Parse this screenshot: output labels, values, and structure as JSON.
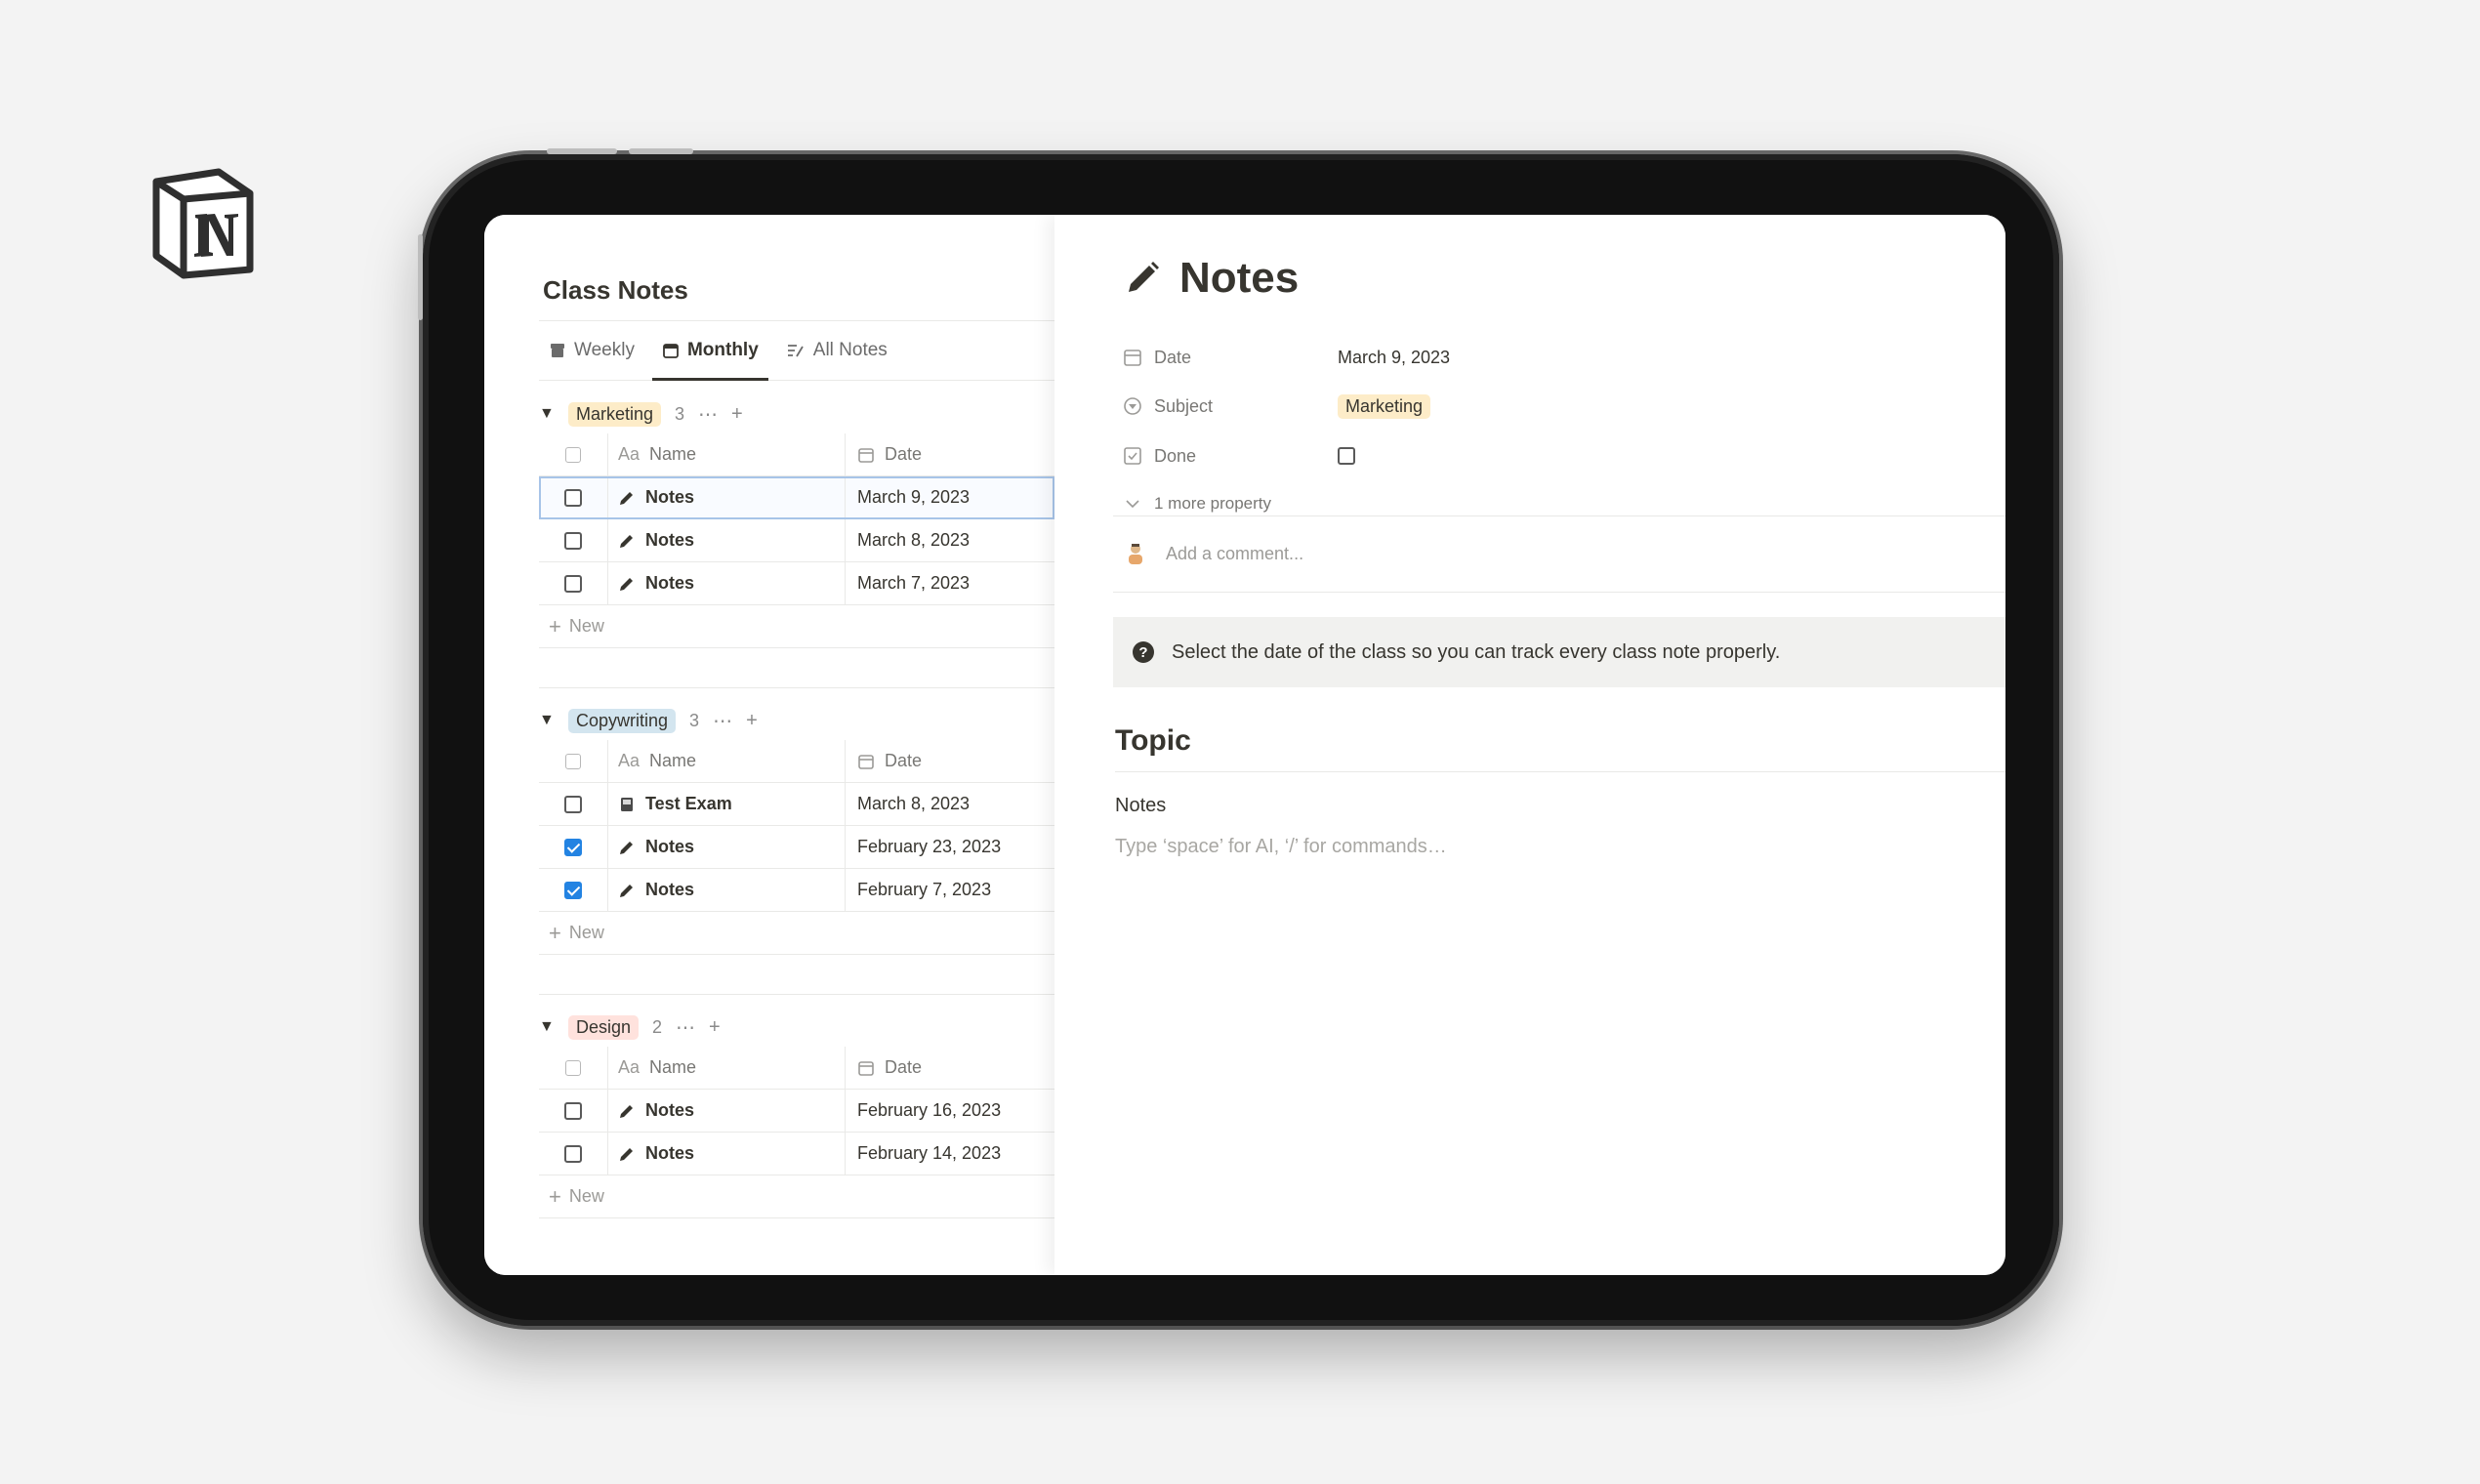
{
  "db": {
    "title": "Class Notes",
    "tabs": [
      {
        "label": "Weekly",
        "icon": "archive-icon"
      },
      {
        "label": "Monthly",
        "icon": "calendar-icon"
      },
      {
        "label": "All Notes",
        "icon": "list-icon"
      }
    ],
    "columns": {
      "name": "Name",
      "name_prefix": "Aa",
      "date": "Date"
    },
    "new_label": "New",
    "groups": [
      {
        "label": "Marketing",
        "count": "3",
        "color": "#fdecc8",
        "rows": [
          {
            "name": "Notes",
            "date": "March 9, 2023",
            "checked": false,
            "icon": "pencil-icon"
          },
          {
            "name": "Notes",
            "date": "March 8, 2023",
            "checked": false,
            "icon": "pencil-icon"
          },
          {
            "name": "Notes",
            "date": "March 7, 2023",
            "checked": false,
            "icon": "pencil-icon"
          }
        ]
      },
      {
        "label": "Copywriting",
        "count": "3",
        "color": "#d3e5ef",
        "rows": [
          {
            "name": "Test Exam",
            "date": "March 8, 2023",
            "checked": false,
            "icon": "notebook-icon"
          },
          {
            "name": "Notes",
            "date": "February 23, 2023",
            "checked": true,
            "icon": "pencil-icon"
          },
          {
            "name": "Notes",
            "date": "February 7, 2023",
            "checked": true,
            "icon": "pencil-icon"
          }
        ]
      },
      {
        "label": "Design",
        "count": "2",
        "color": "#ffe2dd",
        "rows": [
          {
            "name": "Notes",
            "date": "February 16, 2023",
            "checked": false,
            "icon": "pencil-icon"
          },
          {
            "name": "Notes",
            "date": "February 14, 2023",
            "checked": false,
            "icon": "pencil-icon"
          }
        ]
      }
    ]
  },
  "page": {
    "title": "Notes",
    "properties": {
      "date_label": "Date",
      "date_value": "March 9, 2023",
      "subject_label": "Subject",
      "subject_value": "Marketing",
      "done_label": "Done",
      "more": "1 more property"
    },
    "comment_placeholder": "Add a comment...",
    "callout": "Select the date of the class so you can track every class note properly.",
    "topic_heading": "Topic",
    "notes_text": "Notes",
    "editor_placeholder": "Type ‘space’ for AI, ‘/’ for commands…"
  },
  "colors": {
    "accent": "#2383e2",
    "marketing_tag": "#fdecc8",
    "copywriting_tag": "#d3e5ef",
    "design_tag": "#ffe2dd"
  }
}
